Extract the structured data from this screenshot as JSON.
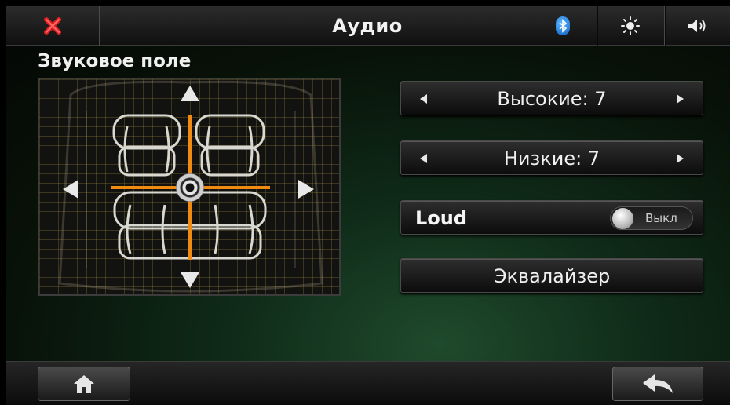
{
  "header": {
    "title": "Аудио",
    "icons": [
      "close-icon",
      "bluetooth-icon",
      "brightness-icon",
      "volume-icon"
    ],
    "close_color": "#e02020",
    "bluetooth_color": "#1e7be6"
  },
  "sound_field": {
    "label": "Звуковое поле",
    "crosshair_color": "#f08a10"
  },
  "treble": {
    "label": "Высокие: 7"
  },
  "bass": {
    "label": "Низкие: 7"
  },
  "loudness": {
    "label": "Loud",
    "toggle_state": "Выкл"
  },
  "equalizer": {
    "label": "Эквалайзер"
  },
  "footer": {
    "icons": [
      "home-icon",
      "back-icon"
    ]
  }
}
